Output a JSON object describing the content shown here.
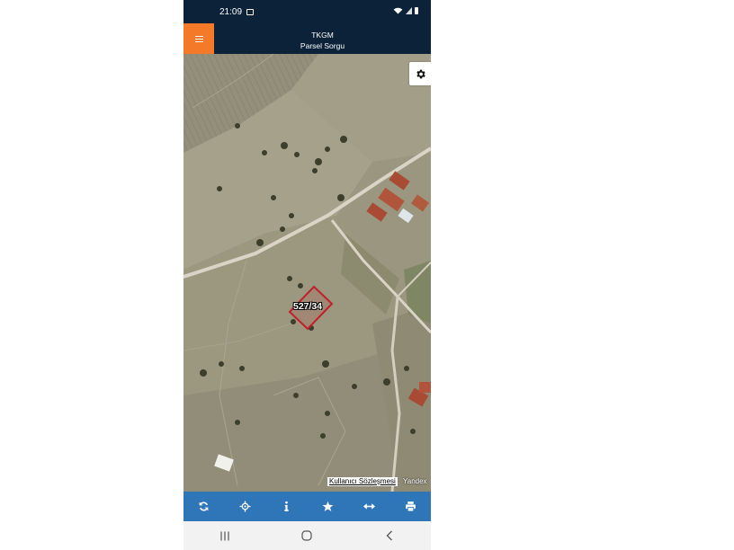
{
  "status_bar": {
    "time": "21:09",
    "icons": [
      "image-icon",
      "wifi-icon",
      "signal-icon",
      "battery-icon"
    ]
  },
  "header": {
    "title_line1": "TKGM",
    "title_line2": "Parsel Sorgu",
    "menu_icon": "hamburger-menu-icon",
    "menu_color": "#f47a2a",
    "background": "#0b2238"
  },
  "map": {
    "parcel_label": "527/34",
    "parcel_outline_color": "#c0202a",
    "terms_link": "Kullanıcı Sözleşmesi",
    "provider": "Yandex",
    "settings_icon": "gear-icon"
  },
  "toolbar": {
    "background": "#2f76b9",
    "buttons": [
      {
        "icon": "refresh-icon"
      },
      {
        "icon": "locate-icon"
      },
      {
        "icon": "info-icon"
      },
      {
        "icon": "star-icon"
      },
      {
        "icon": "measure-icon"
      },
      {
        "icon": "print-icon"
      }
    ]
  },
  "nav_bar": {
    "buttons": [
      {
        "icon": "recent-apps-icon"
      },
      {
        "icon": "home-icon"
      },
      {
        "icon": "back-icon"
      }
    ]
  }
}
